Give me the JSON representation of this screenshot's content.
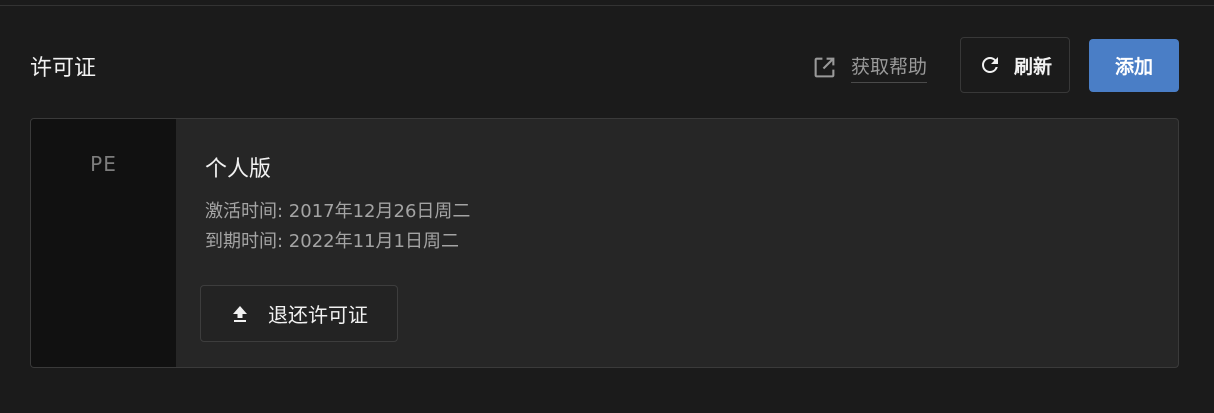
{
  "header": {
    "title": "许可证",
    "help_label": "获取帮助",
    "refresh_label": "刷新",
    "add_label": "添加"
  },
  "license": {
    "edition_code": "PE",
    "edition_name": "个人版",
    "activated": "激活时间: 2017年12月26日周二",
    "expires": "到期时间: 2022年11月1日周二",
    "return_label": "退还许可证"
  },
  "icons": {
    "help": "external-link-icon",
    "refresh": "refresh-icon",
    "return": "upload-arrow-icon"
  },
  "colors": {
    "background": "#1b1b1b",
    "card": "#262626",
    "badge": "#111111",
    "accent": "#4a7ec6"
  }
}
